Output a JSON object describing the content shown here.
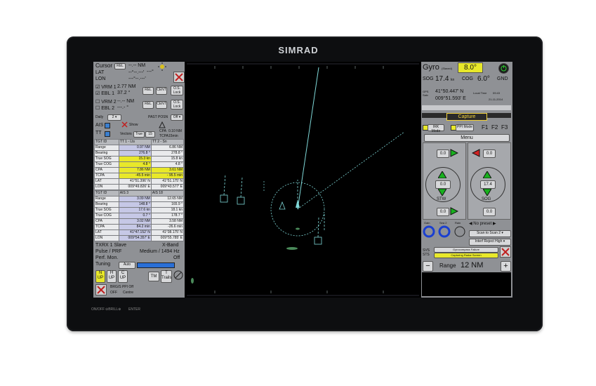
{
  "brand": "SIMRAD",
  "left": {
    "cursor_label": "Cursor",
    "cursor_rel": "REL",
    "cursor_nm": "--.-- NM",
    "cursor_deg": "---°",
    "lat_label": "LAT",
    "lat_value": "--°--.---'",
    "lon_label": "LON",
    "lon_value": "---°--.---'",
    "vrm1_label": "VRM 1",
    "vrm1_value": "2.77 NM",
    "ebl1_label": "EBL 1",
    "ebl1_value": "37.2 °",
    "vrm2_label": "VRM 2",
    "vrm2_value": "--.-- NM",
    "ebl2_label": "EBL 2",
    "ebl2_value": "---.- °",
    "rel": "REL",
    "cent": "CENT",
    "os_lock": "O.S. Lock",
    "daily": "Daily",
    "past_posn": "PAST POSN",
    "off": "Off",
    "ais": "AIS",
    "show": "Show",
    "tt": "TT",
    "vectors": "Vectors",
    "true": "True",
    "vec_min": "15",
    "cpa_label": "CPA",
    "cpa_value": "0.10 NM",
    "tcpa_label": "TCPA",
    "tcpa_value": "15min",
    "tt_headers": [
      "TGT ID",
      "TT 1 - Lts",
      "TT 2 - Sn"
    ],
    "tt_rows": [
      [
        "Range",
        "0.97 NM",
        "6.86 NM"
      ],
      [
        "Bearing",
        "276.8 °",
        "278.8 °"
      ],
      [
        "True SOG",
        "15.3 kn",
        "15.8 kn"
      ],
      [
        "True COG",
        "4.8 °",
        "4.8 °"
      ],
      [
        "CPA",
        "7.86 NM",
        "3.61 NM"
      ],
      [
        "TCPA",
        "-45.5 min",
        "- 95.5 min"
      ],
      [
        "LAT",
        "41°51.396' N",
        "41°51.175' N"
      ],
      [
        "LON",
        "009°49.826' E",
        "009°43.577' E"
      ]
    ],
    "ais_headers": [
      "TGT ID",
      "AIS 3",
      "AIS 18"
    ],
    "ais_rows": [
      [
        "Range",
        "3.09 NM",
        "12.65 NM"
      ],
      [
        "Bearing",
        "148.8 °",
        "165.9 °"
      ],
      [
        "True SOG",
        "17.6 kn",
        "18.1 kn"
      ],
      [
        "True COG",
        "0.7 °",
        "178.7 °"
      ],
      [
        "CPA",
        "3.02 NM",
        "3.58 NM"
      ],
      [
        "TCPA",
        "84.2 min",
        "-26.6 min"
      ],
      [
        "LAT",
        "41°47.152' N",
        "41°38.175' N"
      ],
      [
        "LON",
        "009°54.357' E",
        "009°55.785' E"
      ]
    ],
    "txrx": "TXRX 1 Slave",
    "band": "X-Band",
    "pulse": "Pulse / PRF",
    "pulse_value": "Medium / 1494 Hz",
    "perf": "Perf. Mon.",
    "perf_value": "Off",
    "tuning": "Tuning",
    "auto": "Auto",
    "n_up": "N UP",
    "h_up": "H UP",
    "c_up": "C UP",
    "tm": "TM",
    "t_trails": "T Trails",
    "brg_value": "BRG/S PPI Off",
    "off2": "OFF",
    "centre": "Centre"
  },
  "right": {
    "gyro_label": "Gyro",
    "gyro_sub": "(Slaved)",
    "gyro_value": "8.0°",
    "sog_label": "SOG",
    "sog_value": "17.4",
    "sog_unit": "kn",
    "cog_label": "COG",
    "cog_value": "6.0°",
    "gnd_label": "GND",
    "gps_label": "GPS Satv",
    "lat": "41°50.447' N",
    "lon": "009°51.593' E",
    "local_time_label": "Local Time",
    "local_time": "09:43",
    "date": "21-11-2014",
    "capture_label": "Capture",
    "irk_mode": "IRK Mode",
    "ppi_mode": "PPI Mode",
    "f1": "F1",
    "f2": "F2",
    "f3": "F3",
    "menu": "Menu",
    "val_tl": "0.0",
    "val_tr": "0.0",
    "val_ml": "0.0",
    "val_mr": "17.4",
    "val_bl": "0.0",
    "val_br": "0.0",
    "stw": "STW",
    "sog": "SOG",
    "no_preset": "No preset",
    "scan": "Scan to Scan 2",
    "interf": "Interf Reject High",
    "gain": "Gain",
    "sea": "Sea 2",
    "rain": "Rain",
    "alert1": "Gyrocompass Failure",
    "alert2": "Capturing Radar Screen",
    "svs": "SVS STS",
    "range_label": "Range",
    "range_value": "12 NM",
    "minus": "−",
    "plus": "+"
  },
  "hardware": {
    "onoff": "ON/OFF",
    "brill": "BRILL",
    "enter": "ENTER"
  },
  "colors": {
    "panel_grey": "#8f9195",
    "highlight_yellow": "#e8e82a",
    "green_arrow": "#18b01e",
    "red_arrow": "#d02222",
    "radar_cyan": "#7fd8d8",
    "capture_yellow": "#f2d23a"
  }
}
